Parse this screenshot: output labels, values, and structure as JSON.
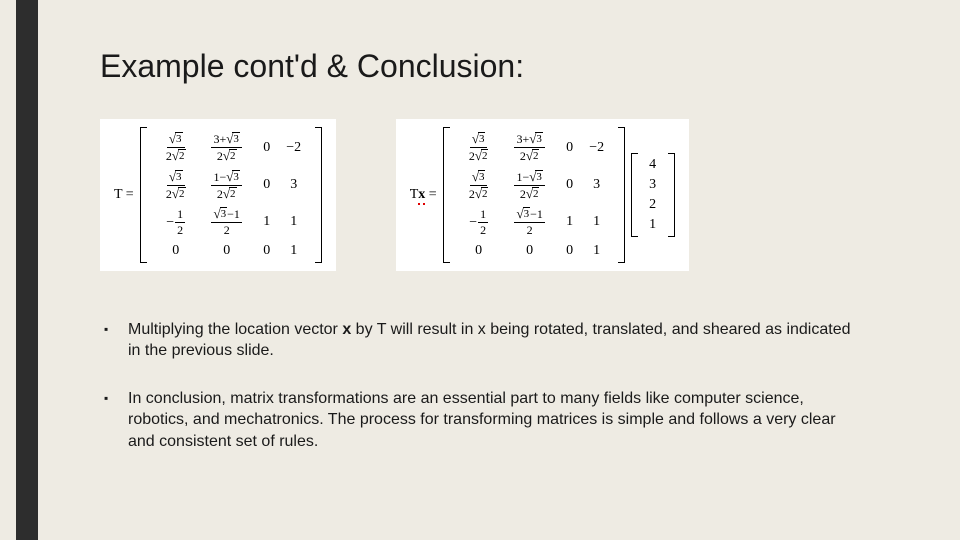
{
  "title": "Example cont'd & Conclusion:",
  "lhs1": "T =",
  "lhs2_pre": "T",
  "lhs2_bold": "x",
  "lhs2_post": " =",
  "T": {
    "r1": {
      "c1_num": "√3",
      "c1_den": "2√2",
      "c2_num": "3+√3",
      "c2_den": "2√2",
      "c3": "0",
      "c4": "−2"
    },
    "r2": {
      "c1_num": "√3",
      "c1_den": "2√2",
      "c2_num": "1−√3",
      "c2_den": "2√2",
      "c3": "0",
      "c4": "3"
    },
    "r3": {
      "c1_num": "1",
      "c1_den": "2",
      "c1_neg": "−",
      "c2_num": "√3−1",
      "c2_den": "2",
      "c3": "1",
      "c4": "1"
    },
    "r4": {
      "c1": "0",
      "c2": "0",
      "c3": "0",
      "c4": "1"
    }
  },
  "x_vec": [
    "4",
    "3",
    "2",
    "1"
  ],
  "bullet1": "Multiplying the location vector x by T will result in x being rotated, translated, and sheared as indicated in the previous slide.",
  "bullet2": "In conclusion, matrix transformations are an essential part to many fields like computer science, robotics, and mechatronics.  The process for transforming matrices is simple and follows a very clear and consistent set of rules."
}
